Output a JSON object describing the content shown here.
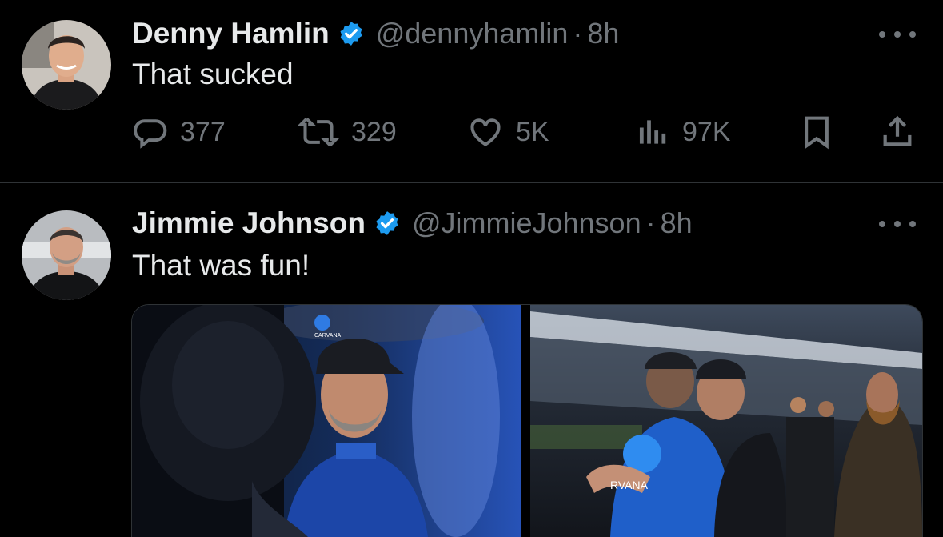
{
  "tweets": [
    {
      "name": "Denny Hamlin",
      "handle": "@dennyhamlin",
      "separator": "·",
      "time": "8h",
      "text": "That sucked",
      "metrics": {
        "replies": "377",
        "reposts": "329",
        "likes": "5K",
        "views": "97K"
      }
    },
    {
      "name": "Jimmie Johnson",
      "handle": "@JimmieJohnson",
      "separator": "·",
      "time": "8h",
      "text": "That was fun!",
      "media": {
        "left_sponsor": "CARVANA",
        "right_sponsor": "RVANA"
      }
    }
  ],
  "colors": {
    "background": "#000000",
    "primary_text": "#e7e9ea",
    "secondary_text": "#71767b",
    "verified": "#1d9bf0",
    "divider": "#2f3336"
  },
  "icons": [
    "verified-badge-icon",
    "more-icon",
    "reply-icon",
    "repost-icon",
    "like-icon",
    "views-icon",
    "bookmark-icon",
    "share-icon"
  ]
}
